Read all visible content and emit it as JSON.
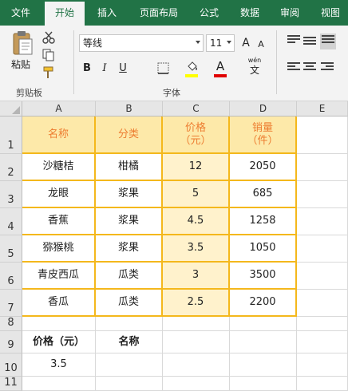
{
  "tabs": [
    {
      "label": "文件",
      "active": false
    },
    {
      "label": "开始",
      "active": true
    },
    {
      "label": "插入",
      "active": false
    },
    {
      "label": "页面布局",
      "active": false
    },
    {
      "label": "公式",
      "active": false
    },
    {
      "label": "数据",
      "active": false
    },
    {
      "label": "审阅",
      "active": false
    },
    {
      "label": "视图",
      "active": false
    }
  ],
  "ribbon": {
    "paste_label": "粘贴",
    "clipboard_group": "剪贴板",
    "font_group": "字体",
    "font_name": "等线",
    "font_size": "11",
    "wen_label": "wén",
    "wen_char": "文",
    "grow_font": "A",
    "shrink_font": "A",
    "bold": "B",
    "italic": "I",
    "underline": "U",
    "font_color_glyph": "A",
    "fill_color": "#ffff00",
    "font_color": "#e00000"
  },
  "columns": [
    "A",
    "B",
    "C",
    "D",
    "E"
  ],
  "rows": [
    "1",
    "2",
    "3",
    "4",
    "5",
    "6",
    "7",
    "8",
    "9",
    "10",
    "11"
  ],
  "table": {
    "headers": [
      "名称",
      "分类",
      "价格\n（元）",
      "销量\n（件）"
    ],
    "rows": [
      [
        "沙糖桔",
        "柑橘",
        "12",
        "2050"
      ],
      [
        "龙眼",
        "浆果",
        "5",
        "685"
      ],
      [
        "香蕉",
        "浆果",
        "4.5",
        "1258"
      ],
      [
        "猕猴桃",
        "浆果",
        "3.5",
        "1050"
      ],
      [
        "青皮西瓜",
        "瓜类",
        "3",
        "3500"
      ],
      [
        "香瓜",
        "瓜类",
        "2.5",
        "2200"
      ]
    ]
  },
  "lookup": {
    "label_price": "价格（元）",
    "label_name": "名称",
    "price_value": "3.5",
    "name_value": ""
  },
  "colors": {
    "tab_bar": "#217346",
    "header_fill": "#fde9a9",
    "header_text": "#ed7d31",
    "price_fill": "#fff2cc",
    "table_border": "#f4b81c"
  }
}
